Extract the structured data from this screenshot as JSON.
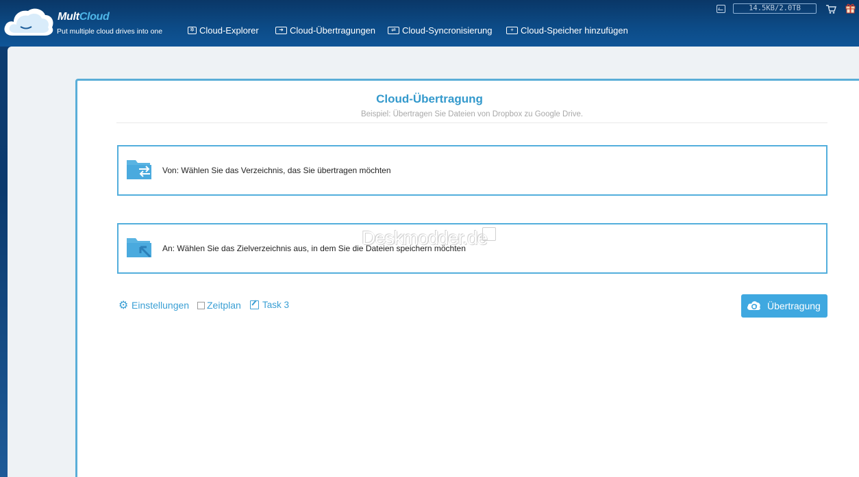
{
  "header": {
    "brand_part1": "Mult",
    "brand_part2": "Cloud",
    "tagline": "Put multiple cloud drives into one",
    "nav": [
      {
        "label": "Cloud-Explorer",
        "icon": "cloud-explorer-icon"
      },
      {
        "label": "Cloud-Übertragungen",
        "icon": "transfer-icon"
      },
      {
        "label": "Cloud-Syncronisierung",
        "icon": "sync-icon"
      },
      {
        "label": "Cloud-Speicher hinzufügen",
        "icon": "add-storage-icon"
      }
    ],
    "storage_usage": "14.5KB/2.0TB"
  },
  "main": {
    "title": "Cloud-Übertragung",
    "subtitle": "Beispiel: Übertragen Sie Dateien von Dropbox zu Google Drive.",
    "source_prompt": "Von: Wählen Sie das Verzeichnis, das Sie übertragen möchten",
    "target_prompt": "An: Wählen Sie das Zielverzeichnis aus, in dem Sie die Dateien speichern möchten",
    "watermark": "Deskmodder.de",
    "options": {
      "settings_label": "Einstellungen",
      "schedule_label": "Zeitplan",
      "schedule_checked": false,
      "task_label": "Task 3"
    },
    "transfer_button": "Übertragung"
  },
  "colors": {
    "accent": "#3fa8e0",
    "header_dark": "#0a3767",
    "title_blue": "#3399cc"
  }
}
